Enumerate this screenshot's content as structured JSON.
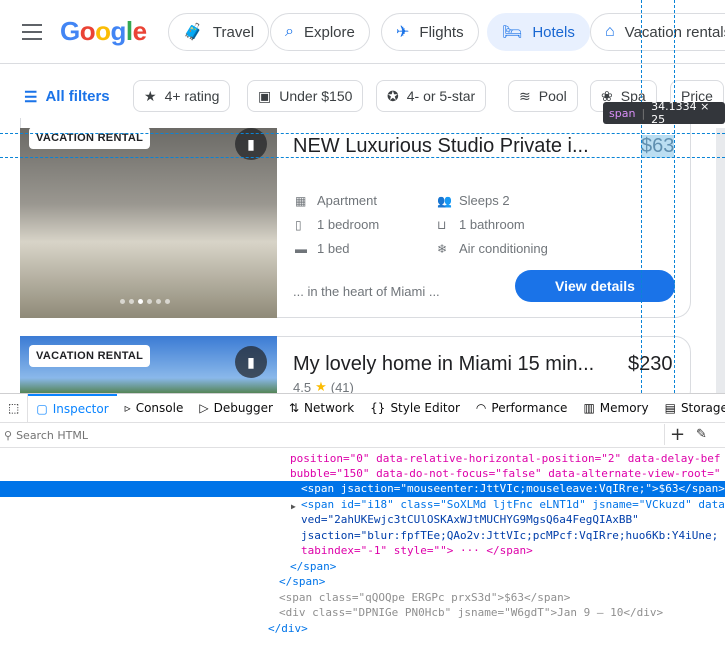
{
  "header": {
    "logo": "Google",
    "chips": [
      {
        "label": "Travel",
        "icon": "travel-icon"
      },
      {
        "label": "Explore",
        "icon": "explore-icon"
      },
      {
        "label": "Flights",
        "icon": "flight-icon"
      },
      {
        "label": "Hotels",
        "icon": "hotel-icon",
        "selected": true
      },
      {
        "label": "Vacation rentals",
        "icon": "home-icon"
      }
    ]
  },
  "filters": {
    "all": "All filters",
    "chips": [
      "4+ rating",
      "Under $150",
      "4- or 5-star",
      "Pool",
      "Spa",
      "Price"
    ]
  },
  "listings": [
    {
      "badge": "VACATION RENTAL",
      "title": "NEW Luxurious Studio Private i...",
      "price": "$63",
      "amenities": [
        "Apartment",
        "Sleeps 2",
        "1 bedroom",
        "1 bathroom",
        "1 bed",
        "Air conditioning"
      ],
      "snippet": "... in the heart of Miami ...",
      "button": "View details"
    },
    {
      "badge": "VACATION RENTAL",
      "title": "My lovely home in Miami 15 min...",
      "price": "$230",
      "rating": "4.5",
      "reviews": "(41)"
    }
  ],
  "highlighter": {
    "tag": "span",
    "size": "34.1334 × 25"
  },
  "devtools": {
    "tabs": [
      "Inspector",
      "Console",
      "Debugger",
      "Network",
      "Style Editor",
      "Performance",
      "Memory",
      "Storage"
    ],
    "search_placeholder": "Search HTML",
    "lines": [
      "position=\"0\" data-relative-horizontal-position=\"2\" data-delay-bef",
      "bubble=\"150\" data-do-not-focus=\"false\" data-alternate-view-root=\"",
      "<span jsaction=\"mouseenter:JttVIc;mouseleave:VqIRre;\">$63</span>",
      "<span id=\"i18\" class=\"SoXLMd ljtFnc eLNT1d\" jsname=\"VCkuzd\" data",
      "ved=\"2ahUKEwjc3tCUlOSKAxWJtMUCHYG9MgsQ6a4FegQIAxBB\"",
      "jsaction=\"blur:fpfTEe;QAo2v:JttVIc;pcMPcf:VqIRre;huo6Kb:Y4iUne;",
      "tabindex=\"-1\" style=\"\"> ··· </span>",
      "</span>",
      "</span>",
      "<span class=\"qQOQpe ERGPc prxS3d\">$63</span>",
      "<div class=\"DPNIGe PN0Hcb\" jsname=\"W6gdT\">Jan 9 – 10</div>",
      "</div>"
    ]
  },
  "colors": {
    "accent": "#1a73e8",
    "selection": "#0074e8"
  }
}
